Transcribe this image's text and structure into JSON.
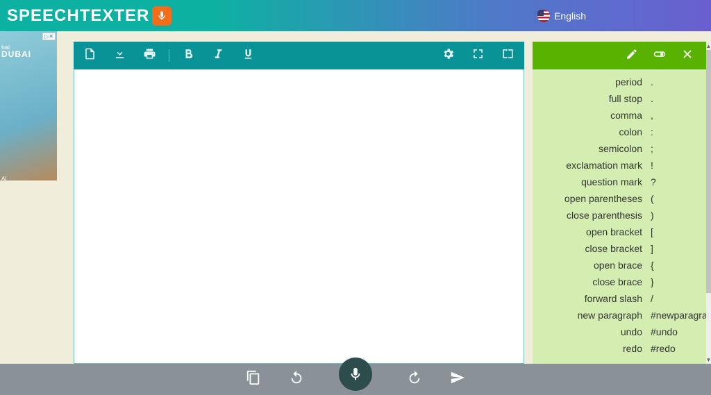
{
  "header": {
    "app_name": "SPEECHTEXTER",
    "language": "English"
  },
  "ad": {
    "subtitle": "bai",
    "title": "DUBAI",
    "badge": " ▷✕",
    "corner": "AI"
  },
  "commands": [
    {
      "name": "period",
      "value": "."
    },
    {
      "name": "full stop",
      "value": "."
    },
    {
      "name": "comma",
      "value": ","
    },
    {
      "name": "colon",
      "value": ":"
    },
    {
      "name": "semicolon",
      "value": ";"
    },
    {
      "name": "exclamation mark",
      "value": "!"
    },
    {
      "name": "question mark",
      "value": "?"
    },
    {
      "name": "open parentheses",
      "value": "("
    },
    {
      "name": "close parenthesis",
      "value": ")"
    },
    {
      "name": "open bracket",
      "value": "["
    },
    {
      "name": "close bracket",
      "value": "]"
    },
    {
      "name": "open brace",
      "value": "{"
    },
    {
      "name": "close brace",
      "value": "}"
    },
    {
      "name": "forward slash",
      "value": "/"
    },
    {
      "name": "new paragraph",
      "value": "#newparagraph"
    },
    {
      "name": "undo",
      "value": "#undo"
    },
    {
      "name": "redo",
      "value": "#redo"
    }
  ]
}
